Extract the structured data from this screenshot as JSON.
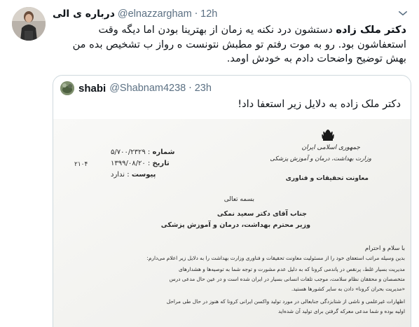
{
  "tweet": {
    "display_name": "درباره ی الی",
    "handle": "@elnazzargham",
    "time": "12h",
    "text_bold": "دکتر ملک زاده",
    "text_rest": " دستشون درد نکنه یه زمان از بهترینا بودن اما دیگه وقت استعفاشون بود. رو به موت رفتم تو مطبش نتونست ه رواز ب تشخیص بده من بهش توضیح واضحات دادم به خودش اومد."
  },
  "quote": {
    "display_name": "shabi",
    "handle": "@Shabnam4238",
    "time": "23h",
    "text": "دکتر ملک زاده به دلایل زیر استعفا داد!",
    "document": {
      "emblem_caption_1": "جمهوری اسلامی ایران",
      "emblem_caption_2": "وزارت بهداشت، درمان و آموزش پزشکی",
      "emblem_caption_3": "معاونت تحقیقات و فناوری",
      "field_number": "شماره",
      "field_number_value": "۵/۷۰۰/۲۳۲۹",
      "field_date": "تاریخ",
      "field_date_value": "۱۳۹۹/۰۸/۲۰",
      "field_attach": "پیوست",
      "field_attach_value": "ندارد",
      "side_code": "۲۱۰۴",
      "bismillah": "بسمه تعالی",
      "addressee_1": "جناب آقای دکتر سعید نمکی",
      "addressee_2": "وزیر محترم بهداشت، درمان و آموزش پزشکی",
      "greeting": "با سلام و احترام",
      "body_1": "بدین وسیله مراتب استعفای خود را از مسئولیت معاونت تحقیقات و فناوری وزارت بهداشت را به دلایل زیر اعلام می‌دارم:",
      "body_2": "مدیریت بسیار غلط، پرنقص در پاندمی کرونا که به دلیل عدم مشورت و توجه شما به توصیه‌ها و هشدارهای",
      "body_3": "متخصصان و محققان نظام سلامت، موجب تلفات انسانی بسیار در ایران شده است و در عین حال مدعی درس",
      "body_4": "«مدیریت بحران کرونا» دادن به سایر کشورها هستید.",
      "body_5": "اظهارات غیرعلمی و ناشی از شتابزدگی جنابعالی در مورد تولید واکسن ایرانی کرونا که هنوز در حال طی مراحل",
      "body_6": "اولیه بوده و شما مدعی معرکه گرفتن برای تولید آن شده‌اید"
    }
  }
}
